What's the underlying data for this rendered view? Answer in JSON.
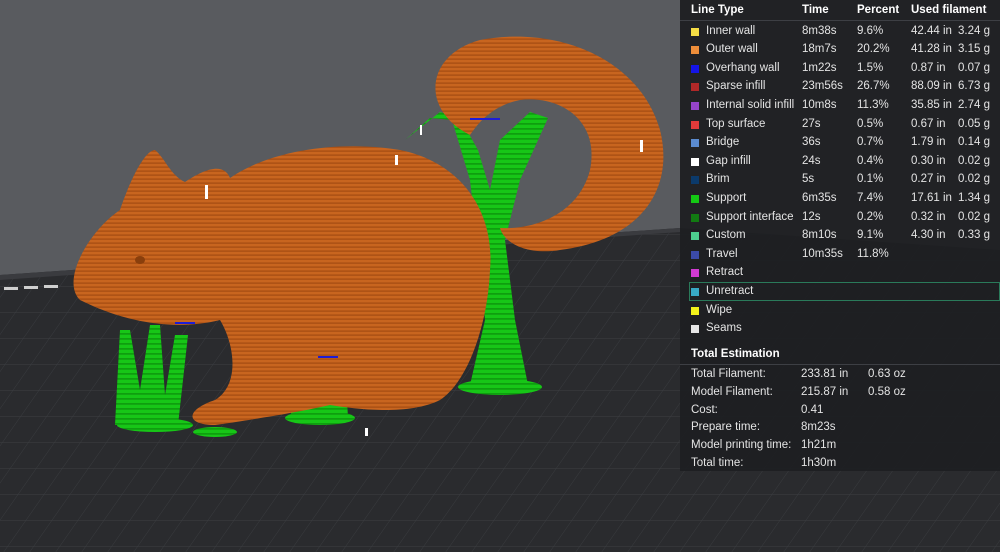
{
  "legend": {
    "headers": {
      "line_type": "Line Type",
      "time": "Time",
      "percent": "Percent",
      "used_filament": "Used filament"
    },
    "rows": [
      {
        "name": "Inner wall",
        "color": "#f5dd45",
        "time": "8m38s",
        "percent": "9.6%",
        "length": "42.44 in",
        "weight": "3.24 g"
      },
      {
        "name": "Outer wall",
        "color": "#ee8e3a",
        "time": "18m7s",
        "percent": "20.2%",
        "length": "41.28 in",
        "weight": "3.15 g"
      },
      {
        "name": "Overhang wall",
        "color": "#1515e6",
        "time": "1m22s",
        "percent": "1.5%",
        "length": "0.87 in",
        "weight": "0.07 g"
      },
      {
        "name": "Sparse infill",
        "color": "#b02828",
        "time": "23m56s",
        "percent": "26.7%",
        "length": "88.09 in",
        "weight": "6.73 g"
      },
      {
        "name": "Internal solid infill",
        "color": "#9544c8",
        "time": "10m8s",
        "percent": "11.3%",
        "length": "35.85 in",
        "weight": "2.74 g"
      },
      {
        "name": "Top surface",
        "color": "#e03a3a",
        "time": "27s",
        "percent": "0.5%",
        "length": "0.67 in",
        "weight": "0.05 g"
      },
      {
        "name": "Bridge",
        "color": "#5b8bd0",
        "time": "36s",
        "percent": "0.7%",
        "length": "1.79 in",
        "weight": "0.14 g"
      },
      {
        "name": "Gap infill",
        "color": "#ffffff",
        "time": "24s",
        "percent": "0.4%",
        "length": "0.30 in",
        "weight": "0.02 g"
      },
      {
        "name": "Brim",
        "color": "#0b3a6b",
        "time": "5s",
        "percent": "0.1%",
        "length": "0.27 in",
        "weight": "0.02 g"
      },
      {
        "name": "Support",
        "color": "#14c814",
        "time": "6m35s",
        "percent": "7.4%",
        "length": "17.61 in",
        "weight": "1.34 g"
      },
      {
        "name": "Support interface",
        "color": "#127a12",
        "time": "12s",
        "percent": "0.2%",
        "length": "0.32 in",
        "weight": "0.02 g"
      },
      {
        "name": "Custom",
        "color": "#4dcf8f",
        "time": "8m10s",
        "percent": "9.1%",
        "length": "4.30 in",
        "weight": "0.33 g"
      },
      {
        "name": "Travel",
        "color": "#3b4aa8",
        "time": "10m35s",
        "percent": "11.8%",
        "length": "",
        "weight": ""
      },
      {
        "name": "Retract",
        "color": "#d23ad2",
        "time": "",
        "percent": "",
        "length": "",
        "weight": ""
      },
      {
        "name": "Unretract",
        "color": "#38a8c4",
        "time": "",
        "percent": "",
        "length": "",
        "weight": "",
        "selected": true
      },
      {
        "name": "Wipe",
        "color": "#f2f21a",
        "time": "",
        "percent": "",
        "length": "",
        "weight": ""
      },
      {
        "name": "Seams",
        "color": "#e6e6e6",
        "time": "",
        "percent": "",
        "length": "",
        "weight": ""
      }
    ]
  },
  "totals": {
    "title": "Total Estimation",
    "rows": [
      {
        "label": "Total Filament:",
        "v1": "233.81 in",
        "v2": "0.63 oz"
      },
      {
        "label": "Model Filament:",
        "v1": "215.87 in",
        "v2": "0.58 oz"
      },
      {
        "label": "Cost:",
        "v1": "0.41",
        "v2": ""
      },
      {
        "label": "Prepare time:",
        "v1": "8m23s",
        "v2": ""
      },
      {
        "label": "Model printing time:",
        "v1": "1h21m",
        "v2": ""
      },
      {
        "label": "Total time:",
        "v1": "1h30m",
        "v2": ""
      }
    ]
  },
  "viewport": {
    "model_color": "#c8651f",
    "support_color": "#16c016",
    "plate_color": "#2b2c2f",
    "background_color": "#585a5e"
  }
}
